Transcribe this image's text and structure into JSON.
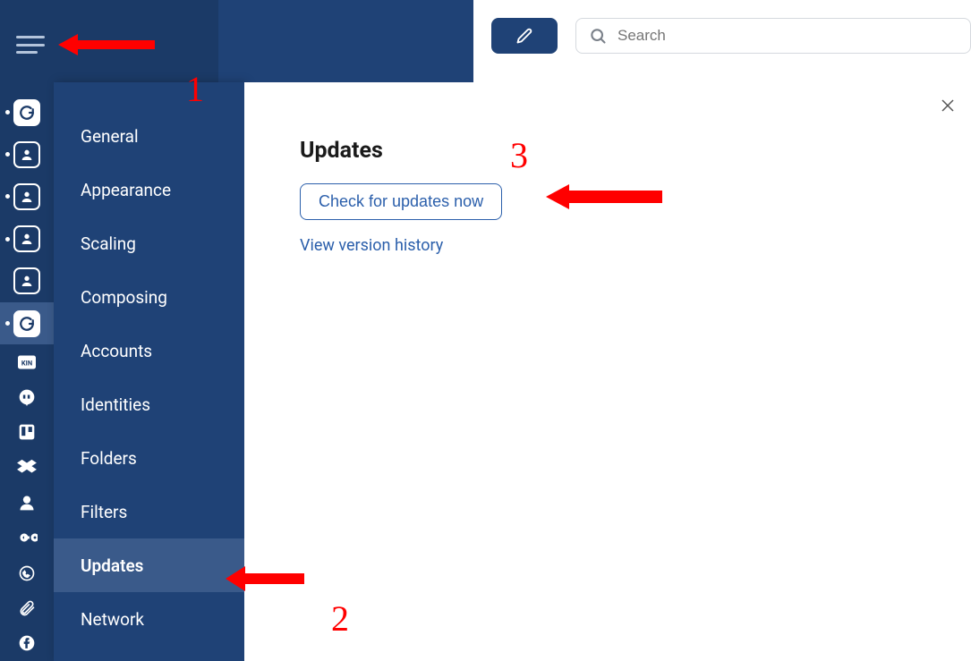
{
  "sidebar": {
    "items": [
      {
        "label": "General"
      },
      {
        "label": "Appearance"
      },
      {
        "label": "Scaling"
      },
      {
        "label": "Composing"
      },
      {
        "label": "Accounts"
      },
      {
        "label": "Identities"
      },
      {
        "label": "Folders"
      },
      {
        "label": "Filters"
      },
      {
        "label": "Updates"
      },
      {
        "label": "Network"
      }
    ]
  },
  "header": {
    "search_placeholder": "Search"
  },
  "main": {
    "title": "Updates",
    "check_button": "Check for updates now",
    "history_link": "View version history"
  },
  "annotations": {
    "n1": "1",
    "n2": "2",
    "n3": "3"
  }
}
